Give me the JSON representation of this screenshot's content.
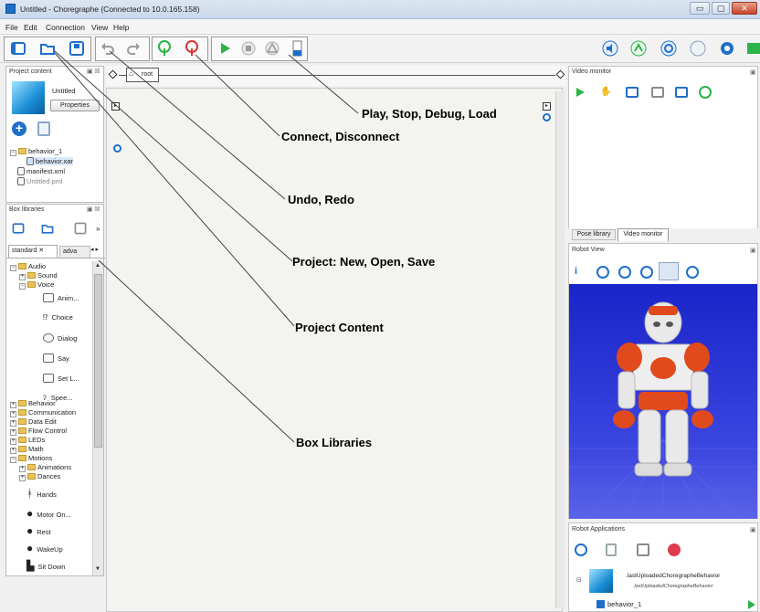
{
  "window": {
    "title": "Untitled - Choregraphe (Connected to 10.0.165.158)",
    "minimize": "▭",
    "maximize": "▢",
    "close": "✕"
  },
  "menu": [
    "File",
    "Edit",
    "Connection",
    "View",
    "Help"
  ],
  "project_content": {
    "title": "Project content",
    "project_name": "Untitled",
    "properties_button": "Properties",
    "tree": [
      "behavior_1",
      "behavior.xar",
      "manifest.xml",
      "Untitled.pml"
    ]
  },
  "box_libraries": {
    "title": "Box libraries",
    "tabs": [
      "standard",
      "adva"
    ],
    "tree": {
      "audio": "Audio",
      "sound": "Sound",
      "voice": "Voice",
      "voice_items": [
        "Anim...",
        "Choice",
        "Dialog",
        "Say",
        "Set L...",
        "Spee..."
      ],
      "categories": [
        "Behavior",
        "Communication",
        "Data Edit",
        "Flow Control",
        "LEDs",
        "Math",
        "Motions"
      ],
      "motion_folders": [
        "Animations",
        "Dances"
      ],
      "motion_items": [
        "Hands",
        "Motor On...",
        "Rest",
        "WakeUp",
        "Sit Down"
      ]
    }
  },
  "canvas": {
    "root_label": "root"
  },
  "callouts": {
    "play": "Play, Stop, Debug, Load",
    "connect": "Connect, Disconnect",
    "undo": "Undo, Redo",
    "project": "Project: New, Open, Save",
    "content": "Project Content",
    "libs": "Box Libraries"
  },
  "video_monitor": {
    "title": "Video monitor",
    "tabs": [
      "Pose library",
      "Video monitor"
    ]
  },
  "robot_view": {
    "title": "Robot View",
    "info_icon": "i"
  },
  "robot_apps": {
    "title": "Robot Applications",
    "app_name": ".lastUploadedChoregrapheBehavior",
    "app_sub": ".lastUploadedChoregrapheBehavior",
    "behavior": "behavior_1"
  },
  "colors": {
    "accent": "#1f6fc9",
    "green": "#2db34a",
    "robot_bg": "#2f3bd6"
  }
}
